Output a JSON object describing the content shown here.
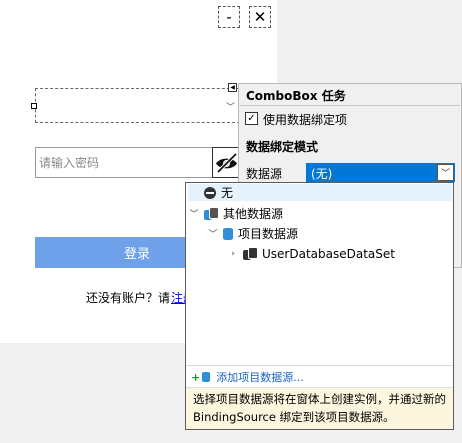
{
  "window": {
    "minimize_glyph": "-",
    "close_glyph": "✕"
  },
  "form": {
    "password_placeholder": "请输入密码",
    "login_label": "登录",
    "no_account_text": "还没有账户？请",
    "register_link": "注册",
    "eye_icon": "eye-slash-icon"
  },
  "task_panel": {
    "title": "ComboBox 任务",
    "use_binding_label": "使用数据绑定项",
    "use_binding_checked": true,
    "binding_mode_heading": "数据绑定模式",
    "data_source_label": "数据源",
    "data_source_value": "(无)"
  },
  "dropdown": {
    "none_label": "无",
    "other_sources_label": "其他数据源",
    "project_sources_label": "项目数据源",
    "dataset_label": "UserDatabaseDataSet",
    "add_link": "添加项目数据源...",
    "description": "选择项目数据源将在窗体上创建实例，并通过新的 BindingSource 绑定到该项目数据源。"
  },
  "colors": {
    "accent": "#0078d7",
    "login_button": "#6fa0ea",
    "link": "#1a66c8",
    "description_bg": "#fbf6dd"
  }
}
